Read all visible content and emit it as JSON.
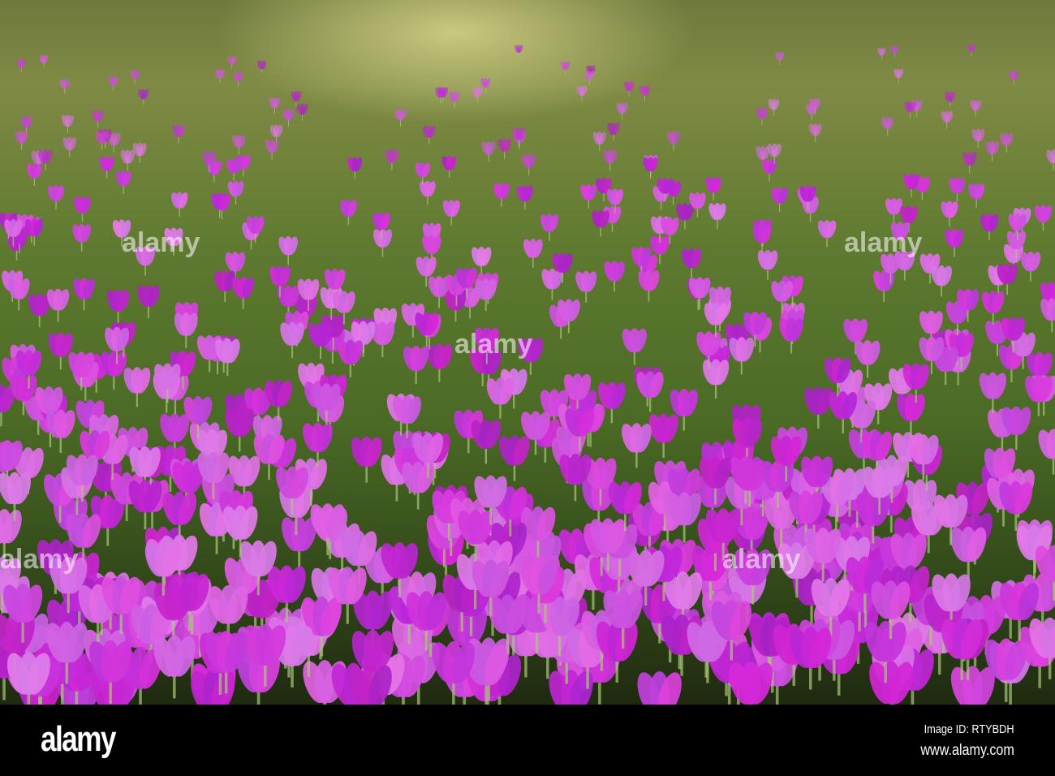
{
  "photo": {
    "subject": "crocus-field"
  },
  "watermark": {
    "brand": "alamy"
  },
  "footer": {
    "logo": "alamy",
    "image_id": "Image ID: RTYBDH",
    "url": "www.alamy.com"
  }
}
